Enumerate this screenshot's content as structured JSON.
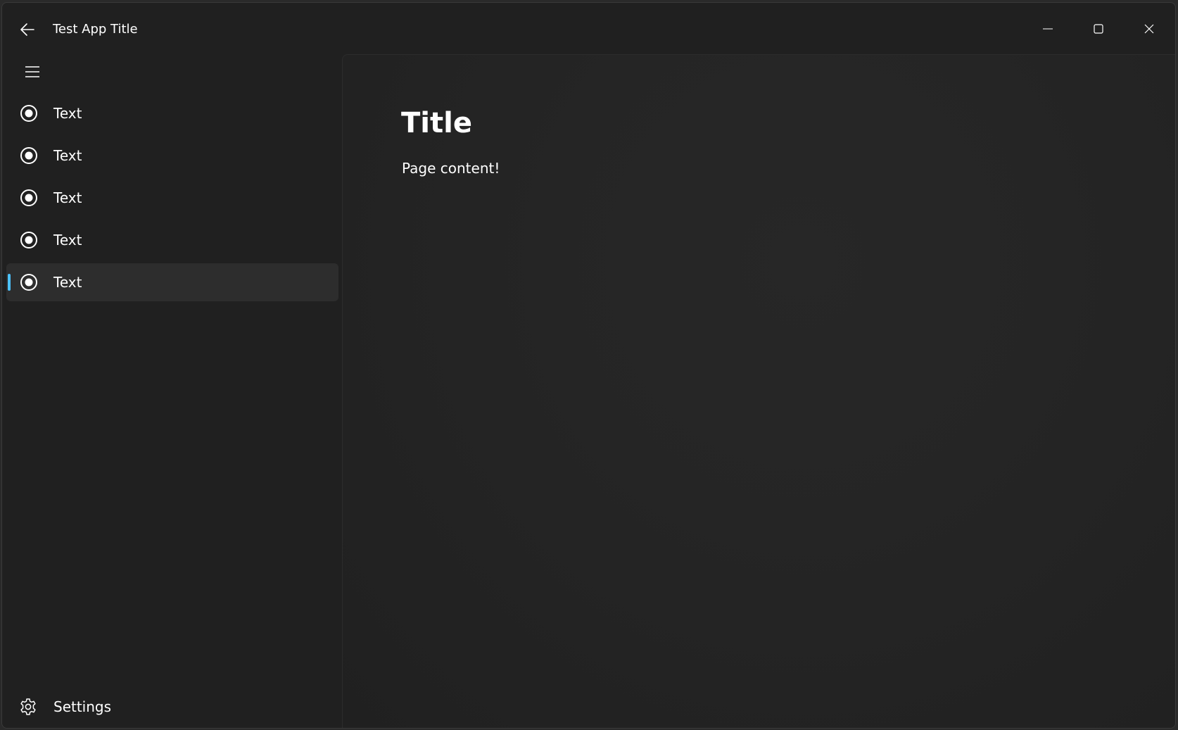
{
  "titlebar": {
    "title": "Test App Title",
    "icons": {
      "back": "back-arrow-icon",
      "minimize": "minimize-icon",
      "maximize": "maximize-icon",
      "close": "close-icon"
    }
  },
  "nav": {
    "menu_icon": "hamburger-icon",
    "items": [
      {
        "label": "Text",
        "icon": "radio-button-icon",
        "selected": false
      },
      {
        "label": "Text",
        "icon": "radio-button-icon",
        "selected": false
      },
      {
        "label": "Text",
        "icon": "radio-button-icon",
        "selected": false
      },
      {
        "label": "Text",
        "icon": "radio-button-icon",
        "selected": false
      },
      {
        "label": "Text",
        "icon": "radio-button-icon",
        "selected": true
      }
    ],
    "settings": {
      "label": "Settings",
      "icon": "gear-icon"
    }
  },
  "content": {
    "title": "Title",
    "body": "Page content!"
  },
  "colors": {
    "background": "#202020",
    "content_background": "#252525",
    "selected_item": "#2d2d2d",
    "accent": "#4cc2ff",
    "text": "#ffffff"
  }
}
